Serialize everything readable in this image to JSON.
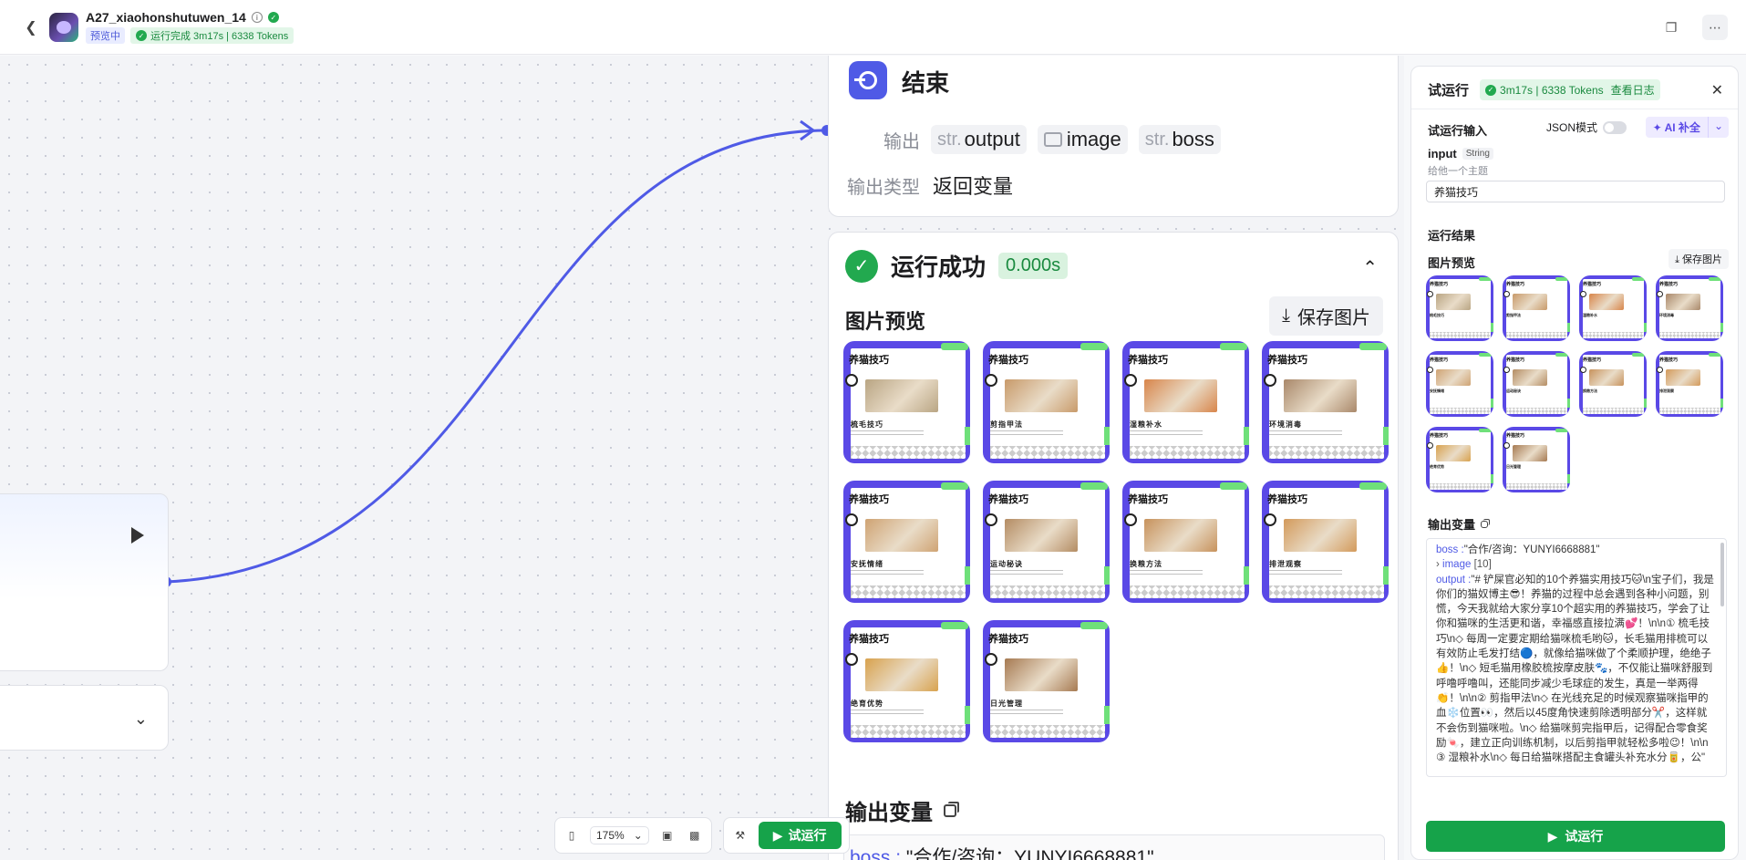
{
  "header": {
    "app_name": "A27_xiaohonshutuwen_14",
    "preview_badge": "预览中",
    "status_text": "运行完成 3m17s | 6338 Tokens"
  },
  "end_node": {
    "title": "结束",
    "output_label": "输出",
    "outputs": [
      {
        "type": "str.",
        "name": "output"
      },
      {
        "type": "image-icon",
        "name": "image"
      },
      {
        "type": "str.",
        "name": "boss"
      }
    ],
    "output_type_label": "输出类型",
    "output_type_value": "返回变量"
  },
  "run_result": {
    "title": "运行成功",
    "time": "0.000s",
    "preview_label": "图片预览",
    "save_label": "保存图片",
    "outvar_label": "输出变量",
    "outvar_boss_key": "boss :",
    "outvar_boss_value": "\"合作/咨询：YUNYI6668881\""
  },
  "images": [
    {
      "title": "养猫技巧",
      "sub": "梳毛技巧",
      "photo": "#b9a583"
    },
    {
      "title": "养猫技巧",
      "sub": "剪指甲法",
      "photo": "#c89a6a"
    },
    {
      "title": "养猫技巧",
      "sub": "湿粮补水",
      "photo": "#d8854a"
    },
    {
      "title": "养猫技巧",
      "sub": "环境消毒",
      "photo": "#a9886a"
    },
    {
      "title": "养猫技巧",
      "sub": "安抚情绪",
      "photo": "#cfa373"
    },
    {
      "title": "养猫技巧",
      "sub": "运动秘诀",
      "photo": "#b48c63"
    },
    {
      "title": "养猫技巧",
      "sub": "换粮方法",
      "photo": "#c7925c"
    },
    {
      "title": "养猫技巧",
      "sub": "排泄观察",
      "photo": "#d39a5b"
    },
    {
      "title": "养猫技巧",
      "sub": "绝育优势",
      "photo": "#d8a24e"
    },
    {
      "title": "养猫技巧",
      "sub": "日光管理",
      "photo": "#a67a52"
    }
  ],
  "toolbar": {
    "zoom": "175%",
    "run_label": "试运行"
  },
  "panel": {
    "title": "试运行",
    "status": "3m17s | 6338 Tokens",
    "view_log": "查看日志",
    "input_section": "试运行输入",
    "json_mode": "JSON模式",
    "ai_fill": "AI 补全",
    "input_name": "input",
    "input_type": "String",
    "input_desc": "给他一个主题",
    "input_value": "养猫技巧",
    "result_section": "运行结果",
    "preview_label": "图片预览",
    "save_label": "保存图片",
    "outvar_label": "输出变量",
    "code_boss_key": "boss :",
    "code_boss_value": "\"合作/咨询：YUNYI6668881\"",
    "code_image": "image",
    "code_image_count": "[10]",
    "code_output_key": "output :",
    "code_output_value": "\"# 铲屎官必知的10个养猫实用技巧🐱\\n宝子们，我是你们的猫奴博主😎！养猫的过程中总会遇到各种小问题，别慌，今天我就给大家分享10个超实用的养猫技巧，学会了让你和猫咪的生活更和谐，幸福感直接拉满💕！\\n\\n① 梳毛技巧\\n◇ 每周一定要定期给猫咪梳毛哟🐱，长毛猫用排梳可以有效防止毛发打结🔵，就像给猫咪做了个柔顺护理，绝绝子👍！\\n◇ 短毛猫用橡胶梳按摩皮肤🐾，不仅能让猫咪舒服到呼噜呼噜叫，还能同步减少毛球症的发生，真是一举两得👏！\\n\\n② 剪指甲法\\n◇ 在光线充足的时候观察猫咪指甲的血❄️位置👀，然后以45度角快速剪除透明部分✂️，这样就不会伤到猫咪啦。\\n◇ 给猫咪剪完指甲后，记得配合零食奖励🍬，建立正向训练机制，以后剪指甲就轻松多啦😉！\\n\\n③ 湿粮补水\\n◇ 每日给猫咪搭配主食罐头补充水分🥫，公\"",
    "run_label": "试运行"
  }
}
